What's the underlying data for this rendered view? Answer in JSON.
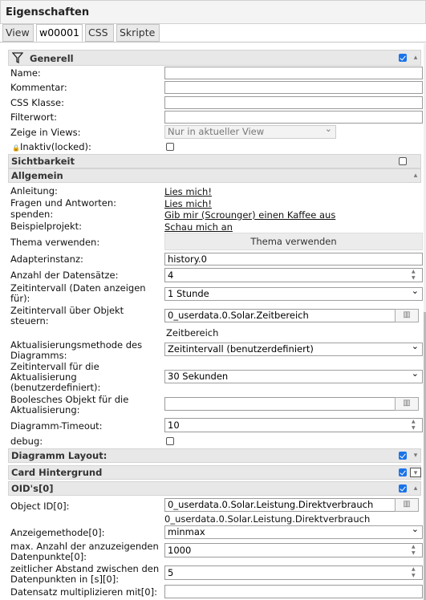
{
  "panel_title": "Eigenschaften",
  "tabs": [
    "View",
    "w00001",
    "CSS",
    "Skripte"
  ],
  "groups": {
    "generell": "Generell",
    "sichtbarkeit": "Sichtbarkeit",
    "allgemein": "Allgemein",
    "diagramm_layout": "Diagramm Layout:",
    "card_hintergrund": "Card Hintergrund",
    "oids": "OID's[0]"
  },
  "generell": {
    "name_label": "Name:",
    "kommentar_label": "Kommentar:",
    "css_label": "CSS Klasse:",
    "filter_label": "Filterwort:",
    "views_label": "Zeige in Views:",
    "views_value": "Nur in aktueller View",
    "locked_label": "Inaktiv(locked):"
  },
  "allgemein": {
    "anleitung_label": "Anleitung:",
    "anleitung_link": "Lies mich!",
    "fragen_label": "Fragen und Antworten:",
    "fragen_link": "Lies mich!",
    "spenden_label": "spenden:",
    "spenden_link": "Gib mir (Scrounger) einen Kaffee aus",
    "beispiel_label": "Beispielprojekt:",
    "beispiel_link": "Schau mich an",
    "thema_label": "Thema verwenden:",
    "thema_button": "Thema verwenden",
    "adapter_label": "Adapterinstanz:",
    "adapter_value": "history.0",
    "anzahl_label": "Anzahl der Datensätze:",
    "anzahl_value": "4",
    "zeitintervall_label_1": "Zeitintervall (Daten anzeigen",
    "zeitintervall_label_2": "für):",
    "zeitintervall_value": "1 Stunde",
    "zeitobjekt_label_1": "Zeitintervall über Objekt",
    "zeitobjekt_label_2": "steuern:",
    "zeitobjekt_value": "0_userdata.0.Solar.Zeitbereich",
    "zeitobjekt_hint": "Zeitbereich",
    "aktmethode_label_1": "Aktualisierungsmethode des",
    "aktmethode_label_2": "Diagramms:",
    "aktmethode_value": "Zeitintervall (benutzerdefiniert)",
    "zeitakt_label_1": "Zeitintervall für die",
    "zeitakt_label_2": "Aktualisierung",
    "zeitakt_label_3": "(benutzerdefiniert):",
    "zeitakt_value": "30 Sekunden",
    "bool_label_1": "Boolesches Objekt für die",
    "bool_label_2": "Aktualisierung:",
    "timeout_label": "Diagramm-Timeout:",
    "timeout_value": "10",
    "debug_label": "debug:"
  },
  "oid": {
    "objectid_label": "Object ID[0]:",
    "objectid_value": "0_userdata.0.Solar.Leistung.Direktverbrauch",
    "objectid_hint": "0_userdata.0.Solar.Leistung.Direktverbrauch",
    "anzeige_label": "Anzeigemethode[0]:",
    "anzeige_value": "minmax",
    "maxanz_label_1": "max. Anzahl der anzuzeigenden",
    "maxanz_label_2": "Datenpunkte[0]:",
    "maxanz_value": "1000",
    "abstand_label_1": "zeitlicher Abstand zwischen den",
    "abstand_label_2": "Datenpunkten in [s][0]:",
    "abstand_value": "5",
    "mult_label": "Datensatz multiplizieren mit[0]:"
  },
  "icons": {
    "filter": "funnel-icon",
    "lock": "lock-icon",
    "dots": "ellipsis-icon"
  },
  "colors": {
    "checkbox": "#1a73e8",
    "group_bg": "#e8e8e8"
  }
}
